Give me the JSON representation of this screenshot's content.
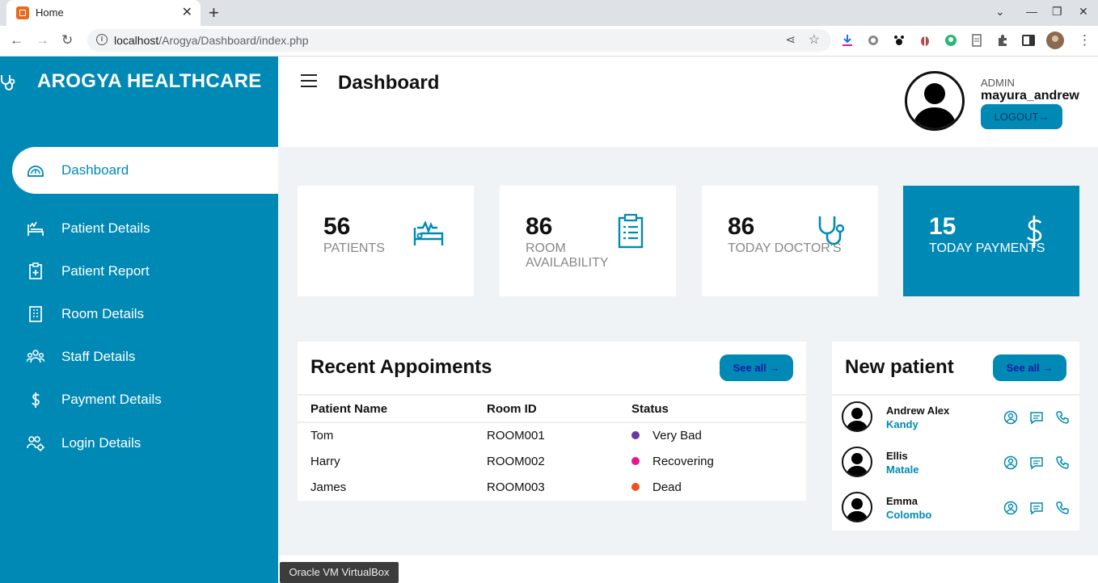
{
  "browser": {
    "tab_title": "Home",
    "url_host": "localhost",
    "url_path": "/Arogya/Dashboard/index.php"
  },
  "brand": {
    "name": "AROGYA HEALTHCARE"
  },
  "sidebar": {
    "items": [
      {
        "label": "Dashboard",
        "icon": "dashboard-icon",
        "active": true
      },
      {
        "label": "Patient Details",
        "icon": "bed-icon"
      },
      {
        "label": "Patient Report",
        "icon": "clipboard-plus-icon"
      },
      {
        "label": "Room Details",
        "icon": "building-icon"
      },
      {
        "label": "Staff Details",
        "icon": "group-icon"
      },
      {
        "label": "Payment Details",
        "icon": "dollar-icon"
      },
      {
        "label": "Login Details",
        "icon": "users-gear-icon"
      }
    ]
  },
  "header": {
    "title": "Dashboard",
    "role": "ADMIN",
    "username": "mayura_andrew",
    "logout_label": "LOGOUT→"
  },
  "cards": [
    {
      "value": "56",
      "label": "PATIENTS",
      "icon": "bed-pulse-icon"
    },
    {
      "value": "86",
      "label": "ROOM AVAILABILITY",
      "icon": "clipboard-list-icon"
    },
    {
      "value": "86",
      "label": "TODAY DOCTOR'S",
      "icon": "stethoscope-icon"
    },
    {
      "value": "15",
      "label": "TODAY PAYMENTS",
      "icon": "dollar-icon"
    }
  ],
  "appointments": {
    "title": "Recent Appoiments",
    "see_all": "See all →",
    "columns": [
      "Patient Name",
      "Room ID",
      "Status"
    ],
    "rows": [
      {
        "name": "Tom",
        "room": "ROOM001",
        "status": "Very Bad",
        "color": "#6a3aa0"
      },
      {
        "name": "Harry",
        "room": "ROOM002",
        "status": "Recovering",
        "color": "#e2168f"
      },
      {
        "name": "James",
        "room": "ROOM003",
        "status": "Dead",
        "color": "#f0501c"
      }
    ]
  },
  "new_patient": {
    "title": "New patient",
    "see_all": "See all →",
    "rows": [
      {
        "name": "Andrew Alex",
        "city": "Kandy"
      },
      {
        "name": "Ellis",
        "city": "Matale"
      },
      {
        "name": "Emma",
        "city": "Colombo"
      }
    ]
  },
  "taskbar": {
    "tooltip": "Oracle VM VirtualBox"
  },
  "colors": {
    "primary": "#0089b5",
    "background": "#f0f3f6"
  }
}
